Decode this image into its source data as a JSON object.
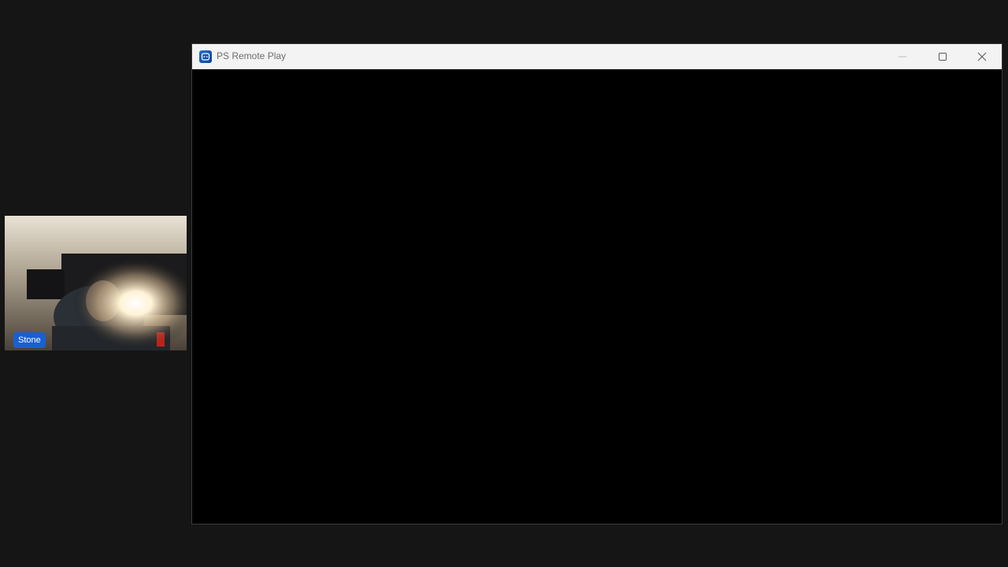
{
  "webcam": {
    "participant_name": "Stone",
    "name_tag_color": "#1a5fd0"
  },
  "window": {
    "title": "PS Remote Play",
    "app_icon": "ps-remote-play-icon",
    "controls": {
      "minimize_icon": "minimize-icon",
      "maximize_icon": "maximize-icon",
      "close_icon": "close-icon"
    }
  },
  "colors": {
    "desktop_background": "#151515",
    "titlebar_background": "#f3f3f3",
    "stream_background": "#000000"
  }
}
